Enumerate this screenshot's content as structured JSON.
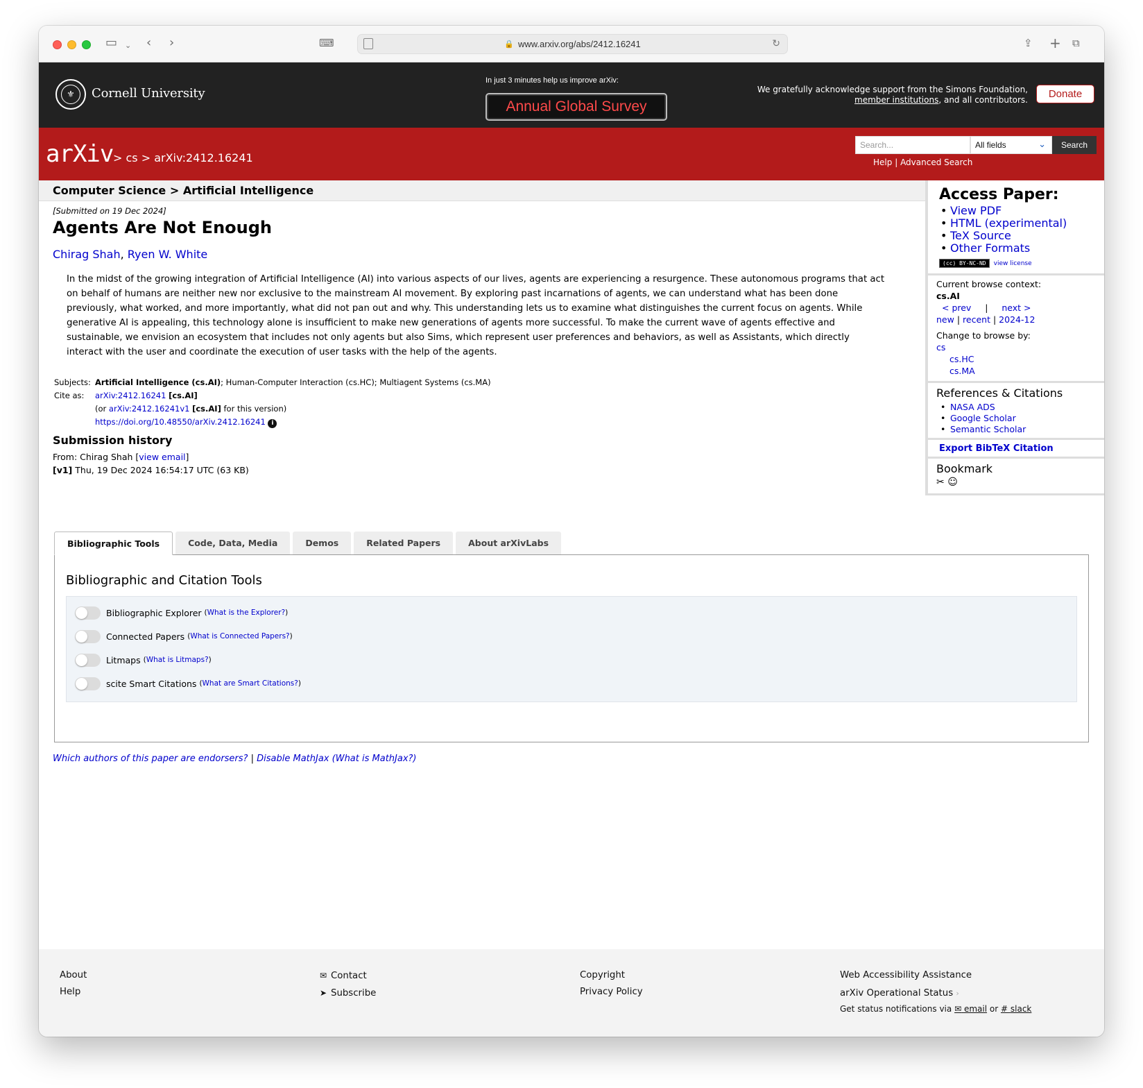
{
  "browser": {
    "url": "www.arxiv.org/abs/2412.16241"
  },
  "cornell": {
    "name": "Cornell University",
    "survey_lead": "In just 3 minutes help us improve arXiv:",
    "survey_button": "Annual Global Survey",
    "ack_line1": "We gratefully acknowledge support from the Simons Foundation,",
    "ack_link": "member institutions",
    "ack_line2_rest": ", and all contributors.",
    "donate": "Donate"
  },
  "arxiv_bar": {
    "logo": "arXiv",
    "breadcrumb": "> cs > arXiv:2412.16241",
    "search_placeholder": "Search...",
    "field_select": "All fields",
    "search_button": "Search",
    "help_link": "Help",
    "advanced_link": "Advanced Search",
    "link_sep": "|"
  },
  "paper": {
    "subject_header": "Computer Science > Artificial Intelligence",
    "submitted": "[Submitted on 19 Dec 2024]",
    "title": "Agents Are Not Enough",
    "authors": [
      "Chirag Shah",
      "Ryen W. White"
    ],
    "author_sep": ", ",
    "abstract": "In the midst of the growing integration of Artificial Intelligence (AI) into various aspects of our lives, agents are experiencing a resurgence. These autonomous programs that act on behalf of humans are neither new nor exclusive to the mainstream AI movement. By exploring past incarnations of agents, we can understand what has been done previously, what worked, and more importantly, what did not pan out and why. This understanding lets us to examine what distinguishes the current focus on agents. While generative AI is appealing, this technology alone is insufficient to make new generations of agents more successful. To make the current wave of agents effective and sustainable, we envision an ecosystem that includes not only agents but also Sims, which represent user preferences and behaviors, as well as Assistants, which directly interact with the user and coordinate the execution of user tasks with the help of the agents.",
    "subjects_label": "Subjects:",
    "subjects_primary": "Artificial Intelligence (cs.AI)",
    "subjects_rest": "; Human-Computer Interaction (cs.HC); Multiagent Systems (cs.MA)",
    "cite_label": "Cite as:",
    "cite_id": "arXiv:2412.16241",
    "cite_cat": "[cs.AI]",
    "cite_or": "(or",
    "cite_v1": "arXiv:2412.16241v1",
    "cite_v1_suffix": "for this version)",
    "doi": "https://doi.org/10.48550/arXiv.2412.16241",
    "history_header": "Submission history",
    "history_from": "From: Chirag Shah [",
    "history_email": "view email",
    "history_from_end": "]",
    "history_v1_label": "[v1]",
    "history_v1": "Thu, 19 Dec 2024 16:54:17 UTC (63 KB)"
  },
  "sidebar": {
    "access_header": "Access Paper:",
    "access_links": [
      "View PDF",
      "HTML (experimental)",
      "TeX Source",
      "Other Formats"
    ],
    "license_badge": "(cc) BY-NC-ND",
    "view_license": "view license",
    "context_label": "Current browse context:",
    "context_value": "cs.AI",
    "prev": "< prev",
    "pipe": "|",
    "next": "next >",
    "new": "new",
    "recent": "recent",
    "month": "2024-12",
    "change_label": "Change to browse by:",
    "browse_cs": "cs",
    "browse_hc": "cs.HC",
    "browse_ma": "cs.MA",
    "refs_header": "References & Citations",
    "refs_links": [
      "NASA ADS",
      "Google Scholar",
      "Semantic Scholar"
    ],
    "bibtex": "Export BibTeX Citation",
    "bookmark_header": "Bookmark"
  },
  "labs": {
    "tabs": [
      "Bibliographic Tools",
      "Code, Data, Media",
      "Demos",
      "Related Papers",
      "About arXivLabs"
    ],
    "header": "Bibliographic and Citation Tools",
    "tools": [
      {
        "label": "Bibliographic Explorer",
        "help": "What is the Explorer?"
      },
      {
        "label": "Connected Papers",
        "help": "What is Connected Papers?"
      },
      {
        "label": "Litmaps",
        "help": "What is Litmaps?"
      },
      {
        "label": "scite Smart Citations",
        "help": "What are Smart Citations?"
      }
    ],
    "endorsers": "Which authors of this paper are endorsers?",
    "disable_mathjax": "Disable MathJax",
    "what_mathjax": "(What is MathJax?)",
    "sep": "|"
  },
  "footer": {
    "about": "About",
    "help": "Help",
    "contact": "Contact",
    "subscribe": "Subscribe",
    "copyright": "Copyright",
    "privacy": "Privacy Policy",
    "accessibility": "Web Accessibility Assistance",
    "status": "arXiv Operational Status",
    "notify": "Get status notifications via",
    "email": "email",
    "or": "or",
    "slack": "slack"
  }
}
